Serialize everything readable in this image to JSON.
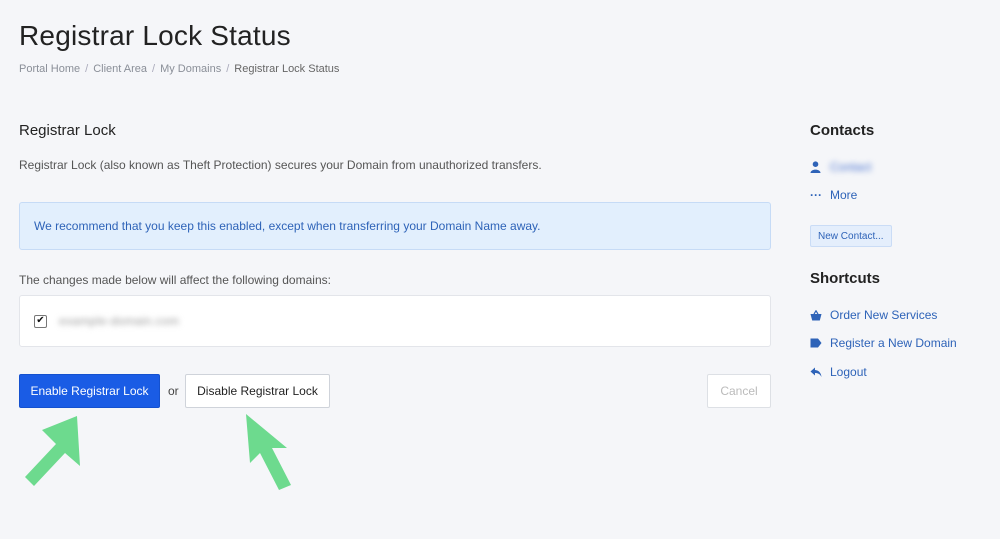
{
  "page": {
    "title": "Registrar Lock Status"
  },
  "breadcrumb": [
    {
      "label": "Portal Home"
    },
    {
      "label": "Client Area"
    },
    {
      "label": "My Domains"
    },
    {
      "label": "Registrar Lock Status"
    }
  ],
  "main": {
    "section_title": "Registrar Lock",
    "description": "Registrar Lock (also known as Theft Protection) secures your Domain from unauthorized transfers.",
    "alert_text": "We recommend that you keep this enabled, except when transferring your Domain Name away.",
    "affect_label": "The changes made below will affect the following domains:",
    "domain": {
      "checked": true,
      "check_glyph": "✔",
      "name": "example-domain.com"
    },
    "buttons": {
      "enable_label": "Enable Registrar Lock",
      "or_text": "or",
      "disable_label": "Disable Registrar Lock",
      "cancel_label": "Cancel"
    }
  },
  "sidebar": {
    "contacts_heading": "Contacts",
    "contact_name": "Contact",
    "more_label": "More",
    "new_contact_label": "New Contact...",
    "shortcuts_heading": "Shortcuts",
    "shortcuts": [
      {
        "label": "Order New Services",
        "icon": "basket-icon"
      },
      {
        "label": "Register a New Domain",
        "icon": "tag-icon"
      },
      {
        "label": "Logout",
        "icon": "back-arrow-icon"
      }
    ]
  },
  "colors": {
    "primary": "#1a5ce5",
    "link": "#2e63b8",
    "alert_bg": "#e2effd",
    "arrow": "#6dda8e"
  }
}
